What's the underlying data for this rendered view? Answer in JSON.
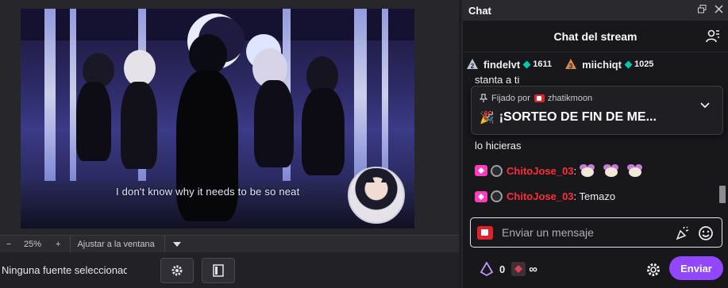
{
  "obs": {
    "subtitle_overlay": "I don't know why it needs to be so neat",
    "zoom": {
      "minus": "−",
      "value": "25%",
      "plus": "+",
      "fit_label": "Ajustar a la ventana"
    },
    "source_status": "Ninguna fuente seleccionada"
  },
  "chat": {
    "dock_title": "Chat",
    "header_title": "Chat del stream",
    "leaderboard": [
      {
        "rank": "2",
        "name": "findelvt",
        "points": "1611",
        "rank_color": "#b8c8d8"
      },
      {
        "rank": "3",
        "name": "miichiqt",
        "points": "1025",
        "rank_color": "#d48a4c"
      }
    ],
    "partial_message": "stanta a ti",
    "pinned": {
      "label": "Fijado por",
      "by": "zhatikmoon",
      "message": "¡SORTEO DE FIN DE ME..."
    },
    "message_line": "lo hicieras",
    "messages": [
      {
        "user": "ChitoJose_03",
        "separator": ":",
        "text": "",
        "emotes": 3
      },
      {
        "user": "ChitoJose_03",
        "separator": ":",
        "text": " Temazo",
        "emotes": 0
      }
    ],
    "input_placeholder": "Enviar un mensaje",
    "channel_points": "0",
    "bits": "∞",
    "send_label": "Enviar"
  },
  "colors": {
    "accent": "#9147ff",
    "username": "#ff2c3c",
    "sub_badge": "#ff3cc0",
    "gem": "#00c8af"
  }
}
